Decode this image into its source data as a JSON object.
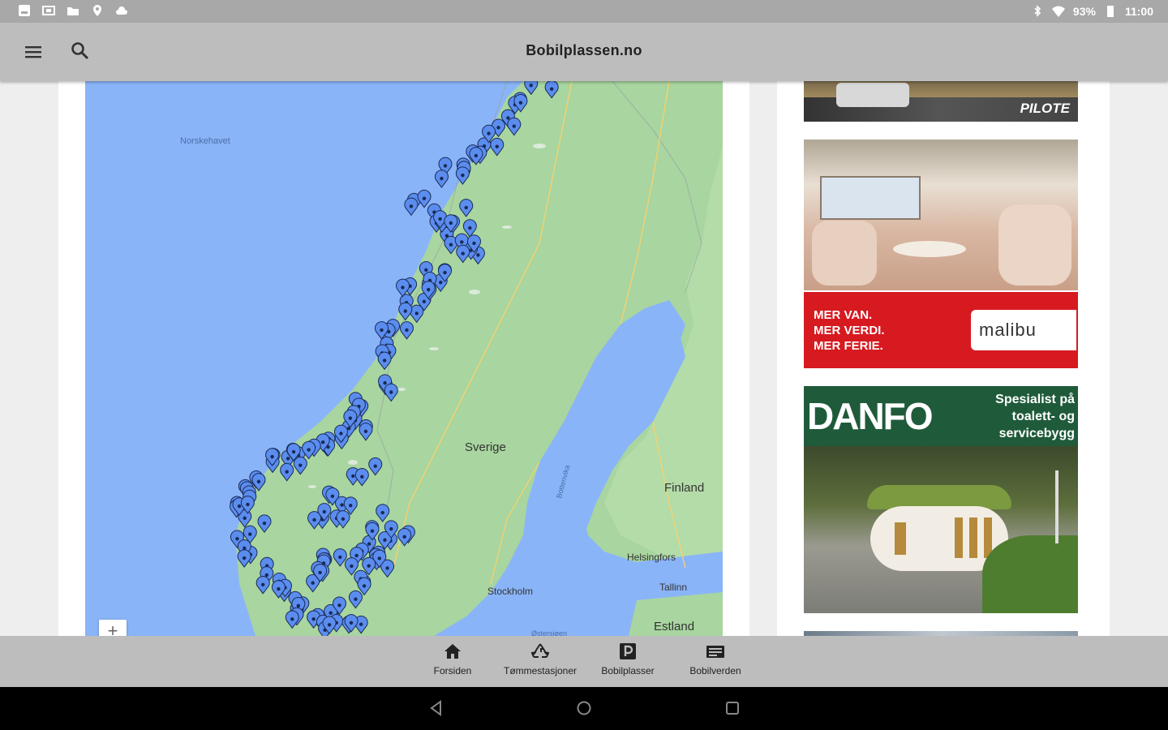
{
  "status_bar": {
    "battery": "93%",
    "time": "11:00",
    "icons": [
      "image-icon",
      "cast-icon",
      "folder-icon",
      "location-icon",
      "cloud-icon",
      "bluetooth-icon",
      "wifi-icon",
      "battery-icon"
    ]
  },
  "app_bar": {
    "title": "Bobilplassen.no",
    "icons": [
      "menu-icon",
      "search-icon"
    ]
  },
  "map": {
    "labels": {
      "sea": "Norskehavet",
      "sweden": "Sverige",
      "finland": "Finland",
      "helsinki": "Helsingfors",
      "stockholm": "Stockholm",
      "tallinn": "Tallinn",
      "estonia": "Estland",
      "gulf": "Bottenvika",
      "sea_bottom": "Østersjøen"
    },
    "zoom_in": "+",
    "colors": {
      "water": "#8ab4f8",
      "land": "#a8d5a0",
      "pin": "#5b8def"
    }
  },
  "ads": {
    "pilote": {
      "brand": "PILOTE"
    },
    "malibu": {
      "lines": [
        "MER VAN.",
        "MER VERDI.",
        "MER FERIE."
      ],
      "brand": "malibu",
      "color": "#d71920"
    },
    "danfo": {
      "brand": "DANFO",
      "tagline": [
        "Spesialist på",
        "toalett- og",
        "servicebygg"
      ],
      "color": "#1f5b3a"
    }
  },
  "bottom_nav": {
    "items": [
      {
        "label": "Forsiden",
        "icon": "home-icon"
      },
      {
        "label": "Tømmestasjoner",
        "icon": "recycle-icon"
      },
      {
        "label": "Bobilplasser",
        "icon": "parking-icon"
      },
      {
        "label": "Bobilverden",
        "icon": "newspaper-icon"
      }
    ]
  },
  "system_nav": {
    "icons": [
      "back-icon",
      "home-circle-icon",
      "recents-icon"
    ]
  }
}
